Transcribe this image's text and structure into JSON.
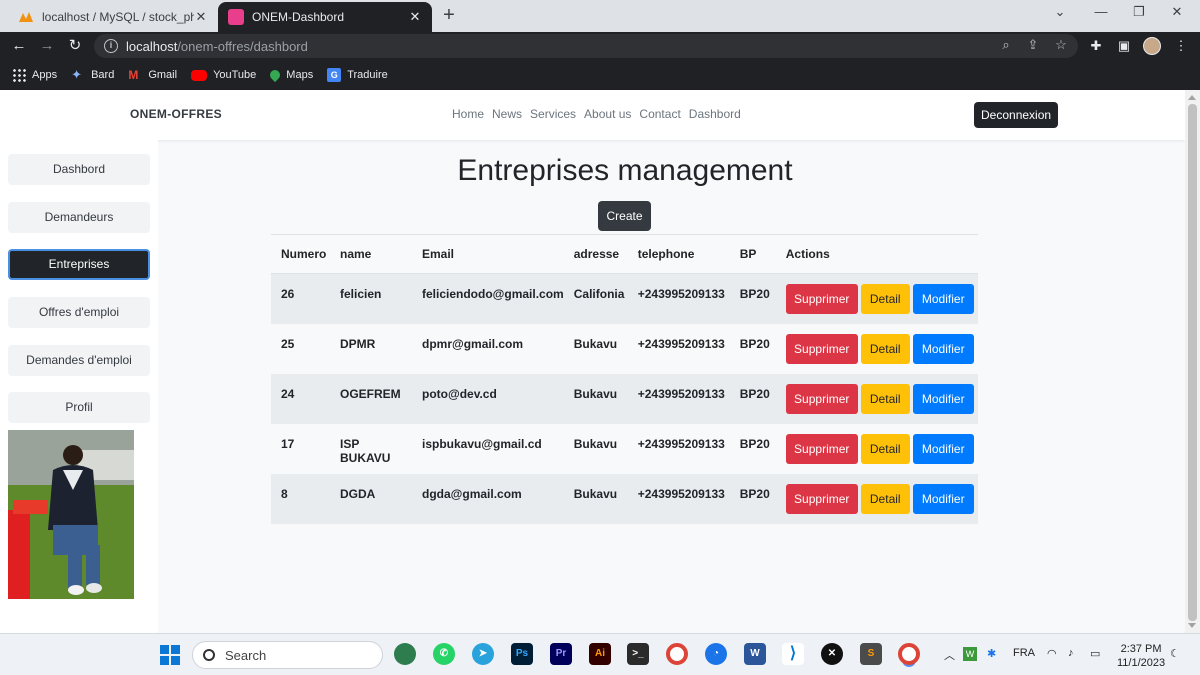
{
  "browser": {
    "tabs": [
      {
        "title": "localhost / MySQL / stock_pharm",
        "active": false
      },
      {
        "title": "ONEM-Dashbord",
        "active": true
      }
    ],
    "url_host": "localhost",
    "url_path": "/onem-offres/dashbord",
    "bookmarks": [
      "Apps",
      "Bard",
      "Gmail",
      "YouTube",
      "Maps",
      "Traduire"
    ]
  },
  "header": {
    "brand": "ONEM-OFFRES",
    "nav": [
      "Home",
      "News",
      "Services",
      "About us",
      "Contact",
      "Dashbord"
    ],
    "logout_label": "Deconnexion"
  },
  "sidebar": {
    "items": [
      {
        "label": "Dashbord",
        "active": false
      },
      {
        "label": "Demandeurs",
        "active": false
      },
      {
        "label": "Entreprises",
        "active": true
      },
      {
        "label": "Offres d'emploi",
        "active": false
      },
      {
        "label": "Demandes d'emploi",
        "active": false
      },
      {
        "label": "Profil",
        "active": false
      }
    ]
  },
  "main": {
    "title": "Entreprises management",
    "create_label": "Create",
    "columns": [
      "Numero",
      "name",
      "Email",
      "adresse",
      "telephone",
      "BP",
      "Actions"
    ],
    "rows": [
      {
        "numero": "26",
        "name": "felicien",
        "email": "feliciendodo@gmail.com",
        "adresse": "Califonia",
        "telephone": "+243995209133",
        "bp": "BP20"
      },
      {
        "numero": "25",
        "name": "DPMR",
        "email": "dpmr@gmail.com",
        "adresse": "Bukavu",
        "telephone": "+243995209133",
        "bp": "BP20"
      },
      {
        "numero": "24",
        "name": "OGEFREM",
        "email": "poto@dev.cd",
        "adresse": "Bukavu",
        "telephone": "+243995209133",
        "bp": "BP20"
      },
      {
        "numero": "17",
        "name": "ISP BUKAVU",
        "email": "ispbukavu@gmail.cd",
        "adresse": "Bukavu",
        "telephone": "+243995209133",
        "bp": "BP20"
      },
      {
        "numero": "8",
        "name": "DGDA",
        "email": "dgda@gmail.com",
        "adresse": "Bukavu",
        "telephone": "+243995209133",
        "bp": "BP20"
      }
    ],
    "actions": {
      "delete": "Supprimer",
      "detail": "Detail",
      "edit": "Modifier"
    }
  },
  "taskbar": {
    "search_placeholder": "Search",
    "language": "FRA",
    "time": "2:37 PM",
    "date": "11/1/2023"
  },
  "colors": {
    "danger": "#dc3545",
    "warning": "#ffc107",
    "primary": "#007bff",
    "dark": "#212529"
  }
}
